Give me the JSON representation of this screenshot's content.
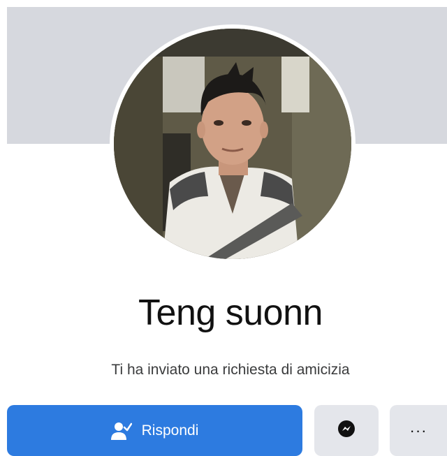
{
  "profile": {
    "name": "Teng suonn",
    "request_text": "Ti ha inviato una richiesta di amicizia"
  },
  "actions": {
    "respond_label": "Rispondi",
    "respond_icon": "person-check-icon",
    "messenger_icon": "messenger-icon",
    "more_label": "···",
    "more_icon": "more-dots-icon"
  },
  "colors": {
    "cover": "#d6d8de",
    "primary_button": "#2d7be0",
    "secondary_button": "#e4e6eb",
    "name_text": "#111111",
    "request_text": "#3a3b3c"
  }
}
